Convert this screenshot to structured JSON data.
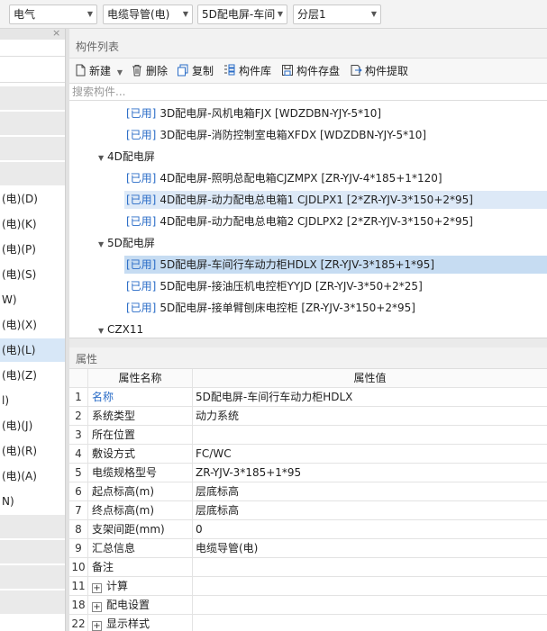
{
  "toolbar": {
    "combo1": "电气",
    "combo2": "电缆导管(电)",
    "combo3": "5D配电屏-车间",
    "combo4": "分层1"
  },
  "left_panel": {
    "close_glyph": "×",
    "rows": [
      {
        "label": "",
        "style": "gray"
      },
      {
        "label": "",
        "style": "gray"
      },
      {
        "label": "",
        "style": "gray"
      },
      {
        "label": "",
        "style": "gray"
      },
      {
        "label": "(电)(D)",
        "style": ""
      },
      {
        "label": "(电)(K)",
        "style": ""
      },
      {
        "label": "(电)(P)",
        "style": ""
      },
      {
        "label": "(电)(S)",
        "style": ""
      },
      {
        "label": "W)",
        "style": ""
      },
      {
        "label": "(电)(X)",
        "style": ""
      },
      {
        "label": "(电)(L)",
        "style": "sel"
      },
      {
        "label": "(电)(Z)",
        "style": ""
      },
      {
        "label": "l)",
        "style": ""
      },
      {
        "label": "(电)(J)",
        "style": ""
      },
      {
        "label": "(电)(R)",
        "style": ""
      },
      {
        "label": "(电)(A)",
        "style": ""
      },
      {
        "label": "N)",
        "style": ""
      },
      {
        "label": "",
        "style": "gray"
      },
      {
        "label": "",
        "style": "gray"
      },
      {
        "label": "",
        "style": "gray"
      },
      {
        "label": "",
        "style": "gray"
      }
    ]
  },
  "component_list": {
    "title": "构件列表",
    "buttons": {
      "new": "新建",
      "delete": "删除",
      "copy": "复制",
      "library": "构件库",
      "save": "构件存盘",
      "extract": "构件提取"
    },
    "search_placeholder": "搜索构件...",
    "used_tag": "[已用]",
    "items": [
      {
        "type": "leaf",
        "text": "3D配电屏-风机电箱FJX [WDZDBN-YJY-5*10]",
        "state": ""
      },
      {
        "type": "leaf",
        "text": "3D配电屏-消防控制室电箱XFDX [WDZDBN-YJY-5*10]",
        "state": ""
      },
      {
        "type": "group",
        "text": "4D配电屏",
        "state": ""
      },
      {
        "type": "leaf",
        "text": "4D配电屏-照明总配电箱CJZMPX [ZR-YJV-4*185+1*120]",
        "state": ""
      },
      {
        "type": "leaf",
        "text": "4D配电屏-动力配电总电箱1 CJDLPX1 [2*ZR-YJV-3*150+2*95]",
        "state": "hl"
      },
      {
        "type": "leaf",
        "text": "4D配电屏-动力配电总电箱2 CJDLPX2 [2*ZR-YJV-3*150+2*95]",
        "state": ""
      },
      {
        "type": "group",
        "text": "5D配电屏",
        "state": ""
      },
      {
        "type": "leaf",
        "text": "5D配电屏-车间行车动力柜HDLX [ZR-YJV-3*185+1*95]",
        "state": "sel"
      },
      {
        "type": "leaf",
        "text": "5D配电屏-接油压机电控柜YYJD [ZR-YJV-3*50+2*25]",
        "state": ""
      },
      {
        "type": "leaf",
        "text": "5D配电屏-接单臂刨床电控柜 [ZR-YJV-3*150+2*95]",
        "state": ""
      },
      {
        "type": "group",
        "text": "CZX11",
        "state": ""
      }
    ]
  },
  "properties": {
    "title": "属性",
    "col_name": "属性名称",
    "col_value": "属性值",
    "rows": [
      {
        "no": "1",
        "name": "名称",
        "value": "5D配电屏-车间行车动力柜HDLX",
        "link": true,
        "expand": false
      },
      {
        "no": "2",
        "name": "系统类型",
        "value": "动力系统",
        "link": false,
        "expand": false
      },
      {
        "no": "3",
        "name": "所在位置",
        "value": "",
        "link": false,
        "expand": false
      },
      {
        "no": "4",
        "name": "敷设方式",
        "value": "FC/WC",
        "link": false,
        "expand": false
      },
      {
        "no": "5",
        "name": "电缆规格型号",
        "value": "ZR-YJV-3*185+1*95",
        "link": false,
        "expand": false
      },
      {
        "no": "6",
        "name": "起点标高(m)",
        "value": "层底标高",
        "link": false,
        "expand": false
      },
      {
        "no": "7",
        "name": "终点标高(m)",
        "value": "层底标高",
        "link": false,
        "expand": false
      },
      {
        "no": "8",
        "name": "支架间距(mm)",
        "value": "0",
        "link": false,
        "expand": false
      },
      {
        "no": "9",
        "name": "汇总信息",
        "value": "电缆导管(电)",
        "link": false,
        "expand": false
      },
      {
        "no": "10",
        "name": "备注",
        "value": "",
        "link": false,
        "expand": false
      },
      {
        "no": "11",
        "name": "计算",
        "value": "",
        "link": false,
        "expand": true
      },
      {
        "no": "18",
        "name": "配电设置",
        "value": "",
        "link": false,
        "expand": true
      },
      {
        "no": "22",
        "name": "显示样式",
        "value": "",
        "link": false,
        "expand": true
      }
    ],
    "plus_glyph": "+"
  },
  "colors": {
    "accent": "#2a6cc7",
    "highlight": "#dde9f7",
    "selected": "#c6dcf2"
  }
}
